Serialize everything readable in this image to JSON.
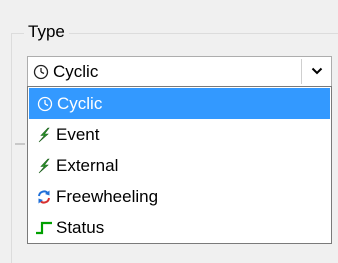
{
  "group": {
    "title": "Type"
  },
  "combo": {
    "selected_label": "Cyclic",
    "selected_icon": "clock-icon"
  },
  "dropdown": {
    "items": [
      {
        "label": "Cyclic",
        "icon": "clock-icon",
        "selected": true
      },
      {
        "label": "Event",
        "icon": "lightning-icon",
        "selected": false
      },
      {
        "label": "External",
        "icon": "lightning-icon",
        "selected": false
      },
      {
        "label": "Freewheeling",
        "icon": "sync-arrows-icon",
        "selected": false
      },
      {
        "label": "Status",
        "icon": "step-signal-icon",
        "selected": false
      }
    ]
  },
  "colors": {
    "selection": "#3399ff",
    "lightning": "#2e9e2e",
    "freewheel_blue": "#1f6fd8",
    "freewheel_red": "#d83030",
    "status_green": "#00a000"
  }
}
